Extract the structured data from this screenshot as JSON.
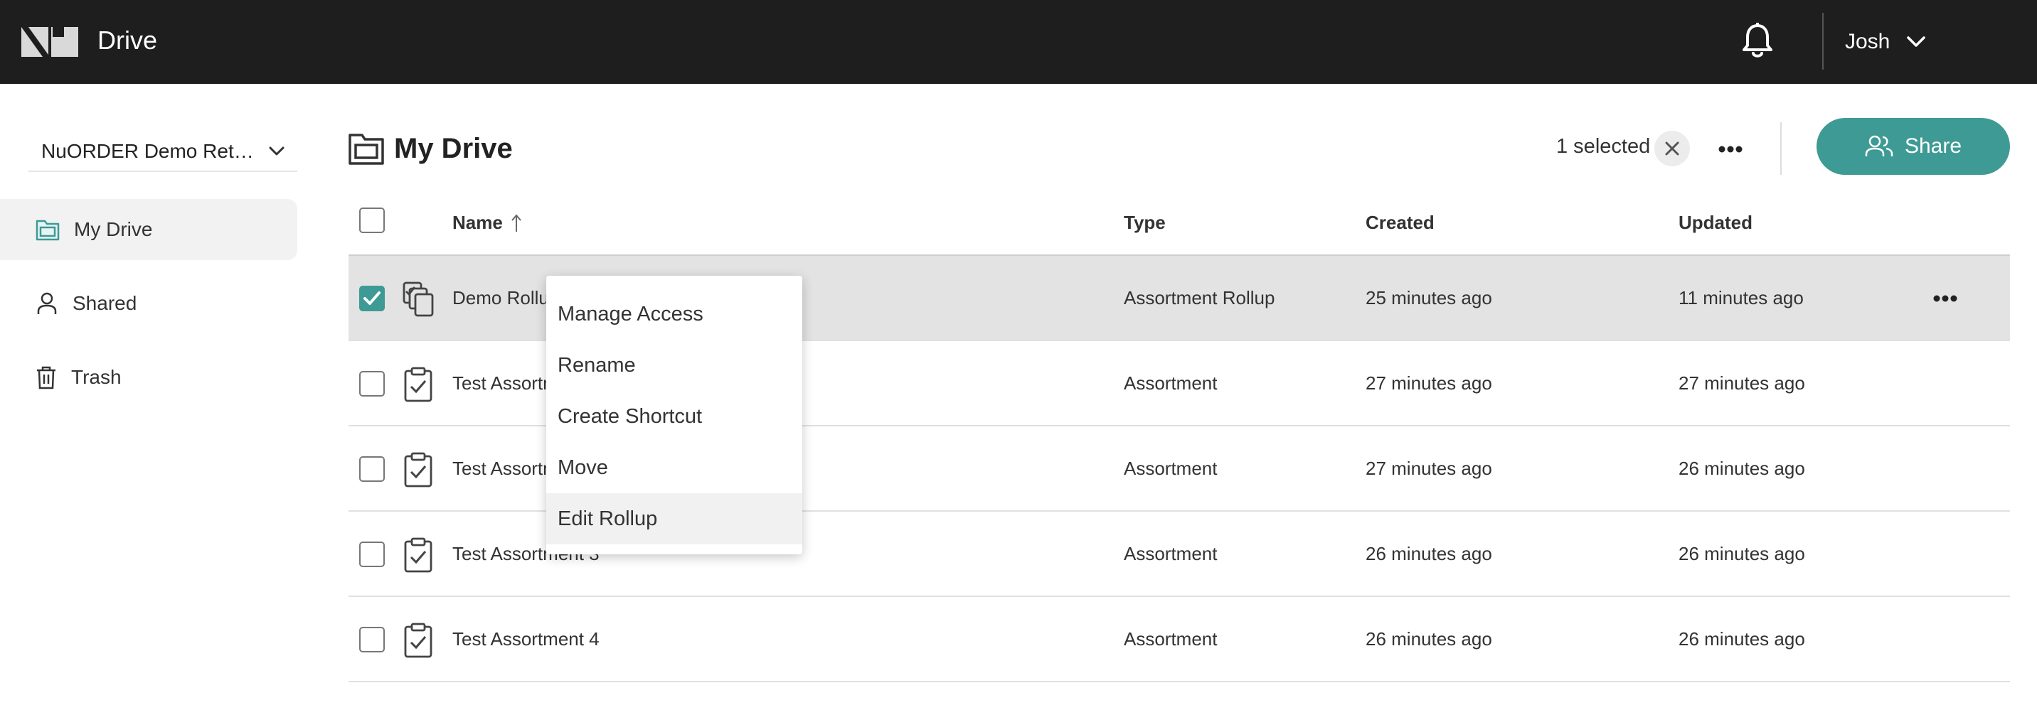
{
  "topbar": {
    "app_title": "Drive",
    "logo_icon": "nuorder-logo-icon",
    "notifications_icon": "bell-icon",
    "user_name": "Josh",
    "user_menu_icon": "chevron-down-icon"
  },
  "sidebar": {
    "retailer": "NuORDER Demo Retailer",
    "items": [
      {
        "label": "My Drive",
        "icon": "folder-icon",
        "active": true
      },
      {
        "label": "Shared",
        "icon": "person-icon",
        "active": false
      },
      {
        "label": "Trash",
        "icon": "trash-icon",
        "active": false
      }
    ]
  },
  "header": {
    "title": "My Drive",
    "title_icon": "folder-icon",
    "selected_count": "1 selected",
    "share_label": "Share",
    "share_icon": "people-icon"
  },
  "table": {
    "columns": {
      "name": "Name",
      "type": "Type",
      "created": "Created",
      "updated": "Updated"
    },
    "sort": {
      "column": "Name",
      "direction": "ascending",
      "icon": "arrow-up-icon"
    },
    "rows": [
      {
        "name": "Demo Rollup",
        "type": "Assortment Rollup",
        "created": "25 minutes ago",
        "updated": "11 minutes ago",
        "icon": "rollup-icon",
        "checked": true
      },
      {
        "name": "Test Assortment 1",
        "type": "Assortment",
        "created": "27 minutes ago",
        "updated": "27 minutes ago",
        "icon": "clipboard-check-icon",
        "checked": false
      },
      {
        "name": "Test Assortment 2",
        "type": "Assortment",
        "created": "27 minutes ago",
        "updated": "26 minutes ago",
        "icon": "clipboard-check-icon",
        "checked": false
      },
      {
        "name": "Test Assortment 3",
        "type": "Assortment",
        "created": "26 minutes ago",
        "updated": "26 minutes ago",
        "icon": "clipboard-check-icon",
        "checked": false
      },
      {
        "name": "Test Assortment 4",
        "type": "Assortment",
        "created": "26 minutes ago",
        "updated": "26 minutes ago",
        "icon": "clipboard-check-icon",
        "checked": false
      }
    ]
  },
  "context_menu": {
    "items": [
      "Manage Access",
      "Rename",
      "Create Shortcut",
      "Move",
      "Edit Rollup"
    ],
    "highlighted": "Edit Rollup"
  },
  "colors": {
    "topbar_bg": "#1e1e1e",
    "accent": "#3e9a94",
    "selected_row_bg": "#e3e3e3",
    "active_nav_bg": "#f2f2f2"
  }
}
